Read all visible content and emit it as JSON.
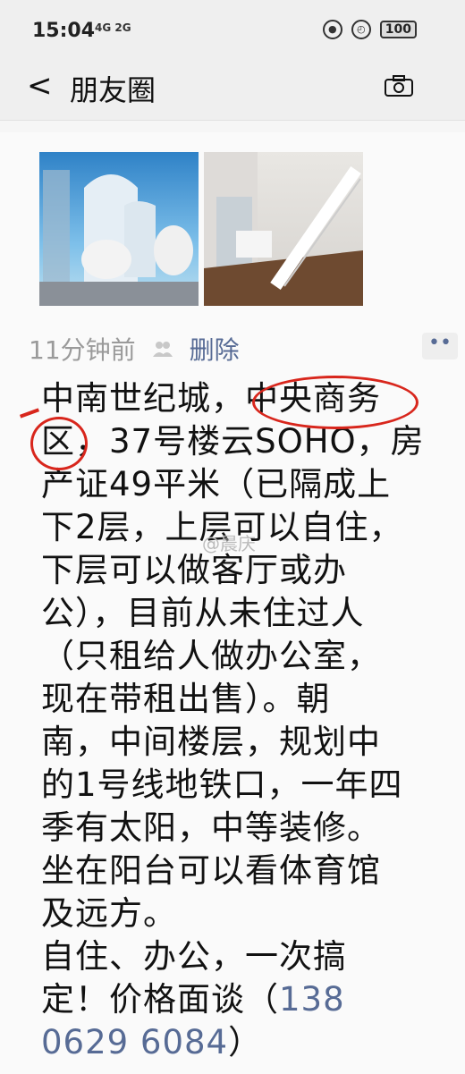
{
  "status": {
    "time": "15:04",
    "signal": "4G 2G",
    "battery": "100"
  },
  "header": {
    "back": "<",
    "title": "朋友圈"
  },
  "post": {
    "time_ago": "11分钟前",
    "delete_label": "删除",
    "text_main": "中南世纪城，中央商务\n区，37号楼云SOHO，房\n产证49平米（已隔成上\n下2层，上层可以自住，\n下层可以做客厅或办\n公），目前从未住过人\n（只租给人做办公室，\n现在带租出售）。朝\n南，中间楼层，规划中\n的1号线地铁口，一年四\n季有太阳，中等装修。\n坐在阳台可以看体育馆\n及远方。\n自住、办公，一次搞\n定！价格面谈（",
    "phone": "138\n0629 6084",
    "text_end": "）",
    "watermark": "@晨庆"
  },
  "icons": {
    "more": "more-icon",
    "camera": "camera-icon",
    "people": "people-icon",
    "back": "back-icon"
  }
}
